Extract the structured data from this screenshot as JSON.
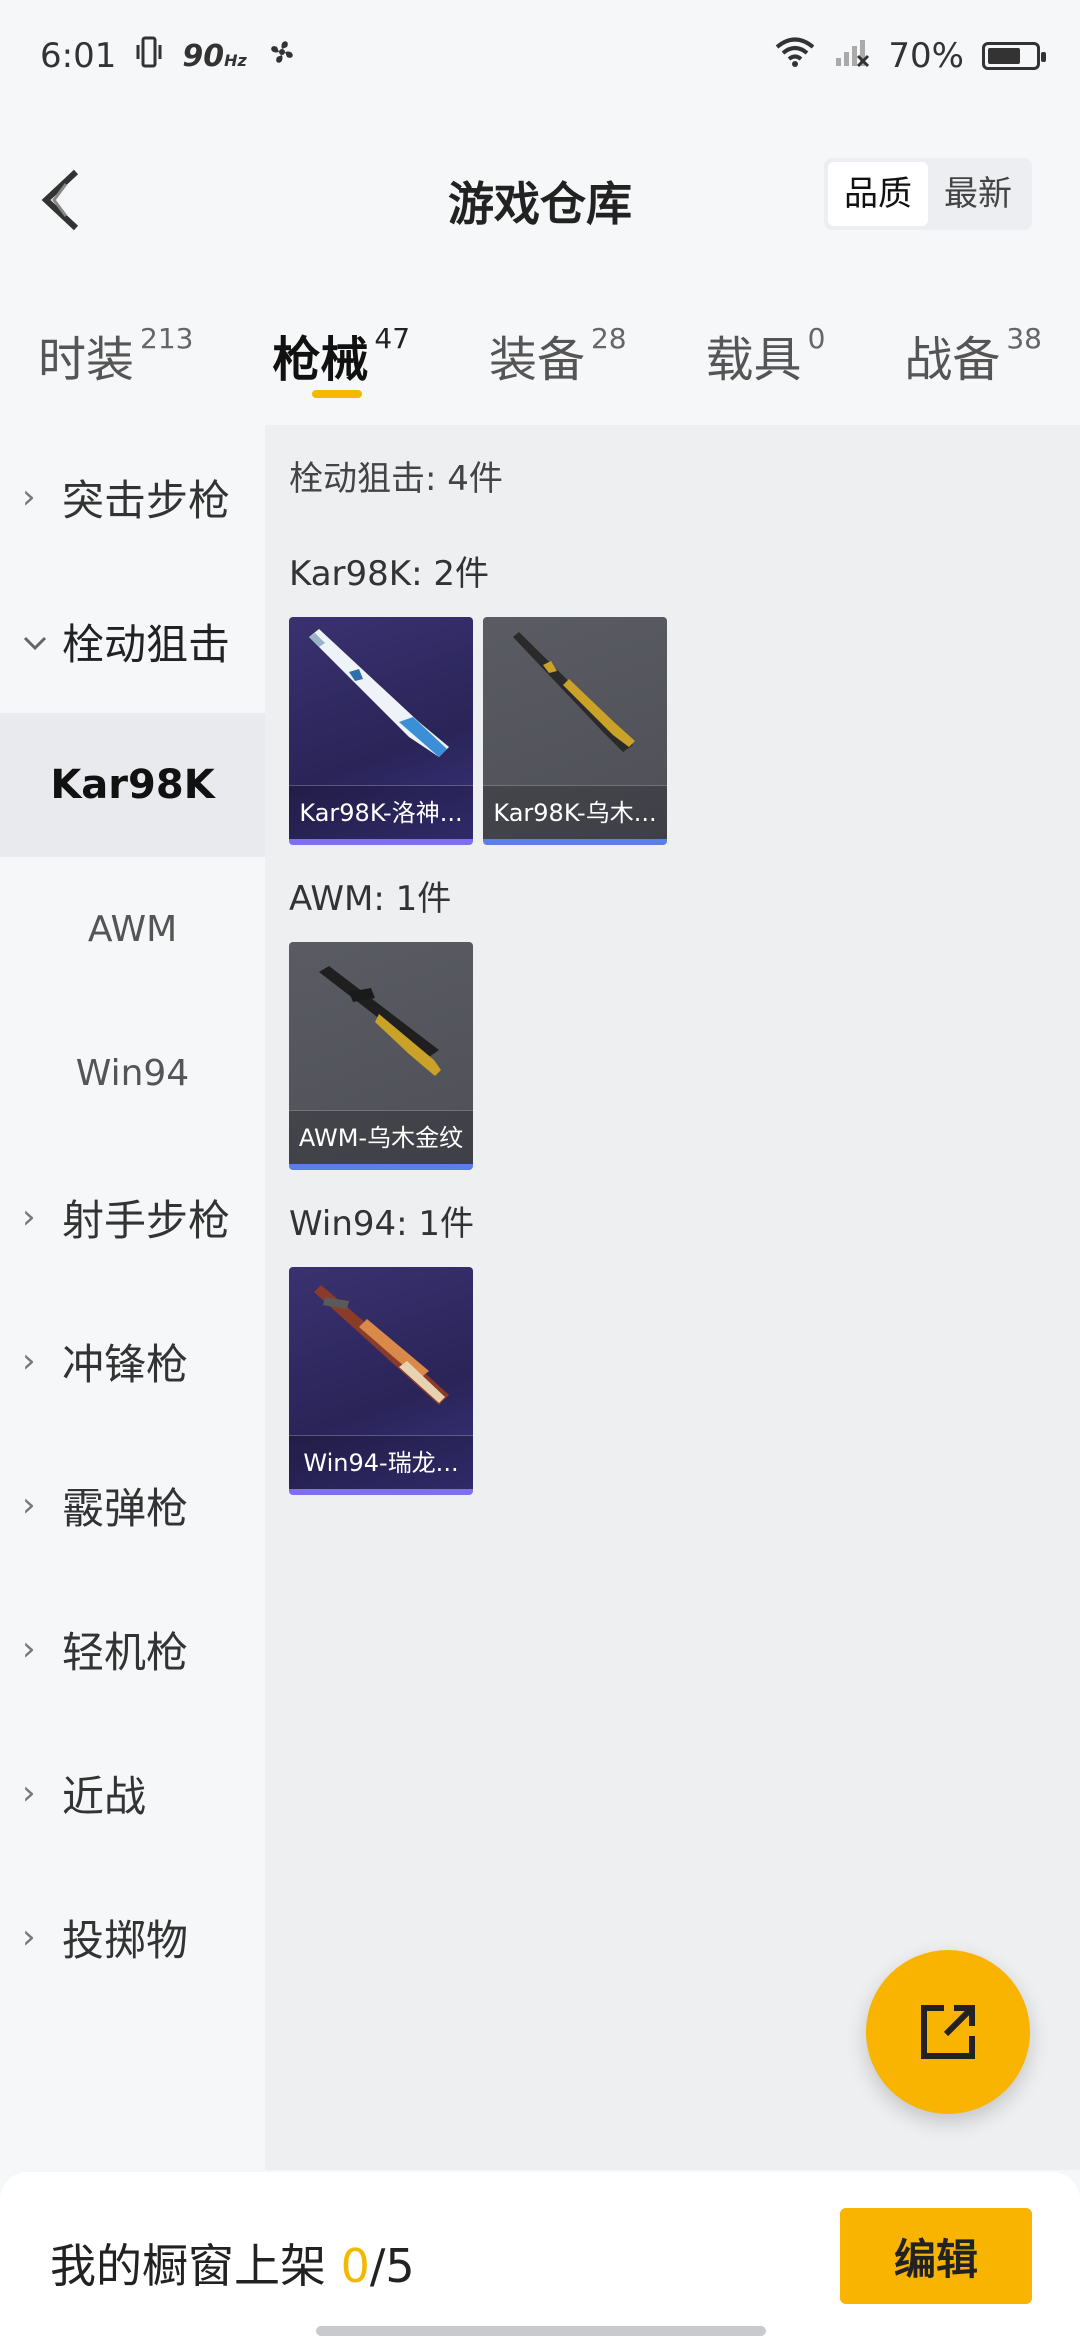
{
  "status_bar": {
    "time": "6:01",
    "refresh_rate": "90",
    "refresh_unit": "Hz",
    "battery": "70%",
    "battery_level": 0.7
  },
  "header": {
    "title": "游戏仓库",
    "sort_options": [
      "品质",
      "最新"
    ],
    "sort_selected": "品质"
  },
  "tabs": [
    {
      "label": "时装",
      "count": "213"
    },
    {
      "label": "枪械",
      "count": "47",
      "active": true
    },
    {
      "label": "装备",
      "count": "28"
    },
    {
      "label": "载具",
      "count": "0"
    },
    {
      "label": "战备",
      "count": "38"
    }
  ],
  "sidebar": {
    "categories": [
      {
        "label": "突击步枪"
      },
      {
        "label": "栓动狙击",
        "expanded": true
      },
      {
        "label": "射手步枪"
      },
      {
        "label": "冲锋枪"
      },
      {
        "label": "霰弹枪"
      },
      {
        "label": "轻机枪"
      },
      {
        "label": "近战"
      },
      {
        "label": "投掷物"
      }
    ],
    "subcategories": [
      {
        "label": "Kar98K",
        "active": true
      },
      {
        "label": "AWM"
      },
      {
        "label": "Win94"
      }
    ]
  },
  "content": {
    "summary": "栓动狙击: 4件",
    "groups": [
      {
        "title": "Kar98K: 2件",
        "items": [
          {
            "label": "Kar98K-洛神...",
            "style": "purple"
          },
          {
            "label": "Kar98K-乌木...",
            "style": "grey"
          }
        ]
      },
      {
        "title": "AWM: 1件",
        "items": [
          {
            "label": "AWM-乌木金纹",
            "style": "grey"
          }
        ]
      },
      {
        "title": "Win94: 1件",
        "items": [
          {
            "label": "Win94-瑞龙...",
            "style": "purple"
          }
        ]
      }
    ]
  },
  "bottom_bar": {
    "showcase_label": "我的橱窗上架",
    "showcase_count": "0",
    "showcase_total": "/5",
    "edit_label": "编辑"
  },
  "colors": {
    "accent": "#f8b400",
    "rare_purple": "#3a3270",
    "common_grey": "#55565e"
  }
}
